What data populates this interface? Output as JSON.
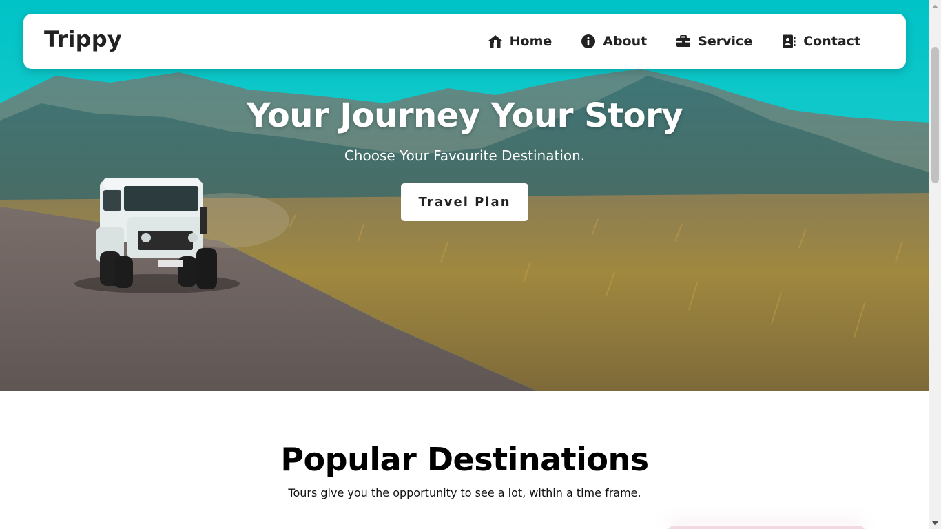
{
  "navbar": {
    "logo": "Trippy",
    "items": [
      {
        "label": "Home",
        "icon": "home-icon"
      },
      {
        "label": "About",
        "icon": "info-icon"
      },
      {
        "label": "Service",
        "icon": "briefcase-icon"
      },
      {
        "label": "Contact",
        "icon": "contact-book-icon"
      }
    ]
  },
  "hero": {
    "title": "Your Journey Your Story",
    "subtitle": "Choose Your Favourite Destination.",
    "button_label": "Travel Plan",
    "background_description_icon": "jeep-landscape-image"
  },
  "popular": {
    "title": "Popular Destinations",
    "subtitle": "Tours give you the opportunity to see a lot, within a time frame."
  },
  "colors": {
    "sky": "#00c2c6",
    "navbar_bg": "#ffffff",
    "text_dark": "#222222",
    "hero_text": "#ffffff"
  }
}
